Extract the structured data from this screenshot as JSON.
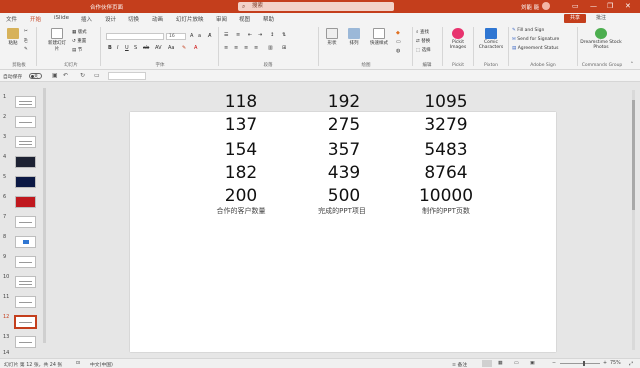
{
  "titlebar": {
    "doc_title": "合作伙伴页面",
    "search_placeholder": "搜索",
    "user_name": "刘能 能",
    "controls": [
      "—",
      "❐",
      "✕"
    ]
  },
  "tabs": [
    "文件",
    "开始",
    "iSlide",
    "插入",
    "设计",
    "切换",
    "动画",
    "幻灯片放映",
    "审阅",
    "视图",
    "帮助"
  ],
  "active_tab": "开始",
  "share_label": "共享",
  "comment_label": "批注",
  "ribbon": {
    "clipboard": {
      "paste": "粘贴",
      "group": "剪贴板"
    },
    "slides": {
      "new_slide": "新建幻灯片",
      "layout": "版式",
      "reset": "重置",
      "section": "节",
      "group": "幻灯片"
    },
    "font": {
      "name": "",
      "size": "16",
      "group": "字体"
    },
    "paragraph": {
      "group": "段落"
    },
    "drawing": {
      "shapes": "形状",
      "arrange": "排列",
      "quick_styles": "快速样式",
      "group": "绘图"
    },
    "editing": {
      "find": "查找",
      "replace": "替换",
      "select": "选择",
      "group": "编辑"
    },
    "pickit": {
      "label": "Pickit Images",
      "group": "Pickit"
    },
    "pixton": {
      "label": "Comic Characters",
      "group": "Pixton"
    },
    "adobe": {
      "fill_sign": "Fill and Sign",
      "send_sig": "Send for Signature",
      "agreement": "Agreement Status",
      "group": "Adobe Sign"
    },
    "dreamstime": {
      "label": "Dreamstime Stock Photos",
      "group": "Commands Group"
    }
  },
  "qat": {
    "autosave": "自动保存",
    "toggle_state": "关"
  },
  "thumbnails": [
    "1",
    "2",
    "3",
    "4",
    "5",
    "6",
    "7",
    "8",
    "9",
    "10",
    "11",
    "12",
    "13",
    "14"
  ],
  "selected_slide": "12",
  "slide": {
    "columns": [
      {
        "values": [
          "118",
          "137",
          "154",
          "182",
          "200"
        ],
        "caption": "合作的客户数量"
      },
      {
        "values": [
          "192",
          "275",
          "357",
          "439",
          "500"
        ],
        "caption": "完成的PPT项目"
      },
      {
        "values": [
          "1095",
          "3279",
          "5483",
          "8764",
          "10000"
        ],
        "caption": "制作的PPT页数"
      }
    ]
  },
  "status": {
    "slide_info": "幻灯片 第 12 张，共 24 张",
    "language": "中文(中国)",
    "notes": "备注",
    "zoom": "75%"
  }
}
